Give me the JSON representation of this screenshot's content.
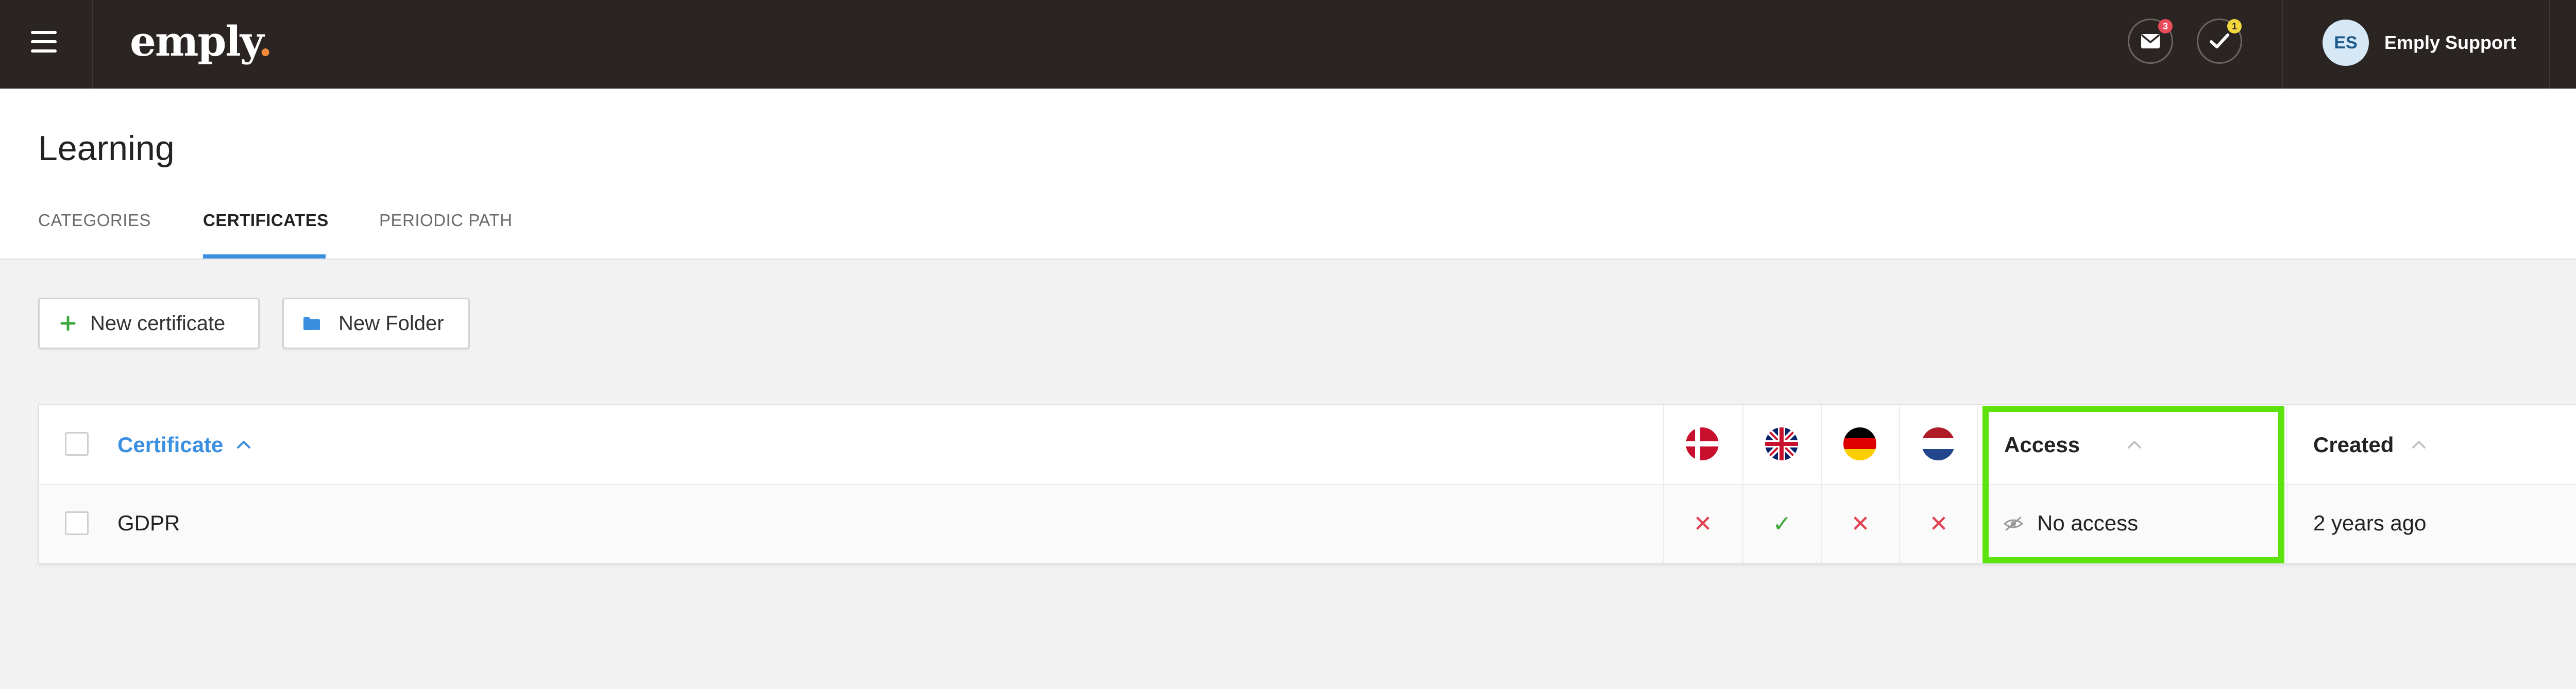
{
  "app": {
    "logo_text": "emply",
    "logo_dot": ".",
    "messages_badge": "3",
    "tasks_badge": "1",
    "user_initials": "ES",
    "user_name": "Emply Support"
  },
  "page": {
    "title": "Learning",
    "tabs": [
      {
        "label": "CATEGORIES",
        "active": false
      },
      {
        "label": "CERTIFICATES",
        "active": true
      },
      {
        "label": "PERIODIC PATH",
        "active": false
      }
    ]
  },
  "toolbar": {
    "new_certificate_label": "New certificate",
    "new_folder_label": "New Folder"
  },
  "table": {
    "columns": {
      "certificate": "Certificate",
      "access": "Access",
      "created": "Created"
    },
    "languages": [
      "da",
      "en",
      "de",
      "nl"
    ],
    "rows": [
      {
        "certificate": "GDPR",
        "languages": {
          "da": "✕",
          "en": "✓",
          "de": "✕",
          "nl": "✕"
        },
        "access": "No access",
        "created": "2 years ago"
      }
    ]
  },
  "colors": {
    "topbar": "#2a2522",
    "accent": "#3b8fe0",
    "highlight": "#5ce30c",
    "unavailable": "#e04050",
    "available": "#3aa83a"
  }
}
